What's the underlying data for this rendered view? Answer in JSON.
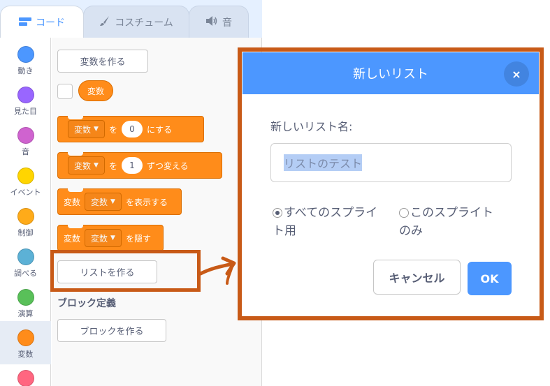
{
  "tabs": [
    {
      "label": "コード",
      "icon": "code-icon"
    },
    {
      "label": "コスチューム",
      "icon": "brush-icon"
    },
    {
      "label": "音",
      "icon": "speaker-icon"
    }
  ],
  "categories": [
    {
      "label": "動き",
      "color": "#4c97ff"
    },
    {
      "label": "見た目",
      "color": "#9966ff"
    },
    {
      "label": "音",
      "color": "#cf63cf"
    },
    {
      "label": "イベント",
      "color": "#ffd500"
    },
    {
      "label": "制御",
      "color": "#ffab19"
    },
    {
      "label": "調べる",
      "color": "#5cb1d6"
    },
    {
      "label": "演算",
      "color": "#59c059"
    },
    {
      "label": "変数",
      "color": "#ff8c1a"
    },
    {
      "label": "",
      "color": "#ff6680"
    }
  ],
  "palette": {
    "make_variable": "変数を作る",
    "reporter": "変数",
    "blocks": [
      {
        "lead": "",
        "dropdown": "変数",
        "mid": "を",
        "value": "0",
        "tail": "にする"
      },
      {
        "lead": "",
        "dropdown": "変数",
        "mid": "を",
        "value": "1",
        "tail": "ずつ変える"
      },
      {
        "lead": "変数",
        "dropdown": "変数",
        "mid": "",
        "value": "",
        "tail": "を表示する"
      },
      {
        "lead": "変数",
        "dropdown": "変数",
        "mid": "",
        "value": "",
        "tail": "を隠す"
      }
    ],
    "make_list": "リストを作る",
    "section_title": "ブロック定義",
    "make_block": "ブロックを作る"
  },
  "dialog": {
    "title": "新しいリスト",
    "close": "×",
    "label": "新しいリスト名:",
    "input_value": "リストのテスト",
    "option_all_line1": "すべてのスプライ",
    "option_all_line2": "ト用",
    "option_this_line1": "このスプライト",
    "option_this_line2": "のみ",
    "cancel": "キャンセル",
    "ok": "OK"
  },
  "colors": {
    "accent": "#4c97ff",
    "variables": "#ff8c1a",
    "highlight": "#c85a17"
  }
}
